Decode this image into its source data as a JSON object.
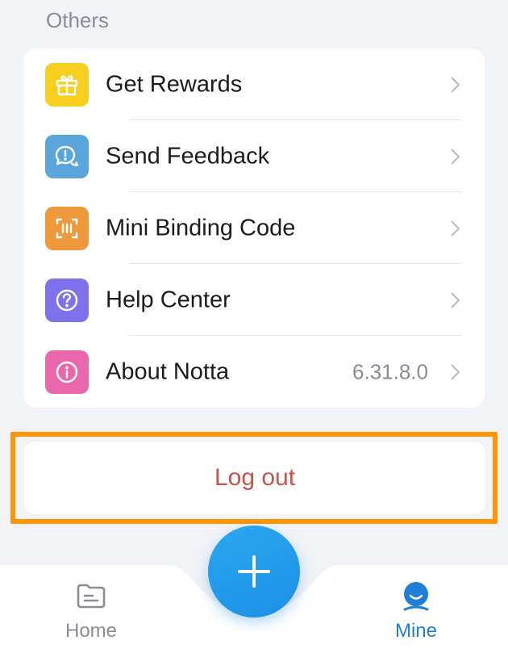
{
  "section": {
    "title": "Others"
  },
  "items": [
    {
      "label": "Get Rewards",
      "value": "",
      "icon": "gift-icon",
      "color": "#f7cf1e"
    },
    {
      "label": "Send Feedback",
      "value": "",
      "icon": "feedback-icon",
      "color": "#5aa6dc"
    },
    {
      "label": "Mini Binding Code",
      "value": "",
      "icon": "scan-code-icon",
      "color": "#ee9a3c"
    },
    {
      "label": "Help Center",
      "value": "",
      "icon": "help-icon",
      "color": "#7d72ec"
    },
    {
      "label": "About Notta",
      "value": "6.31.8.0",
      "icon": "info-icon",
      "color": "#ea67ad"
    }
  ],
  "logout": {
    "label": "Log out",
    "color": "#c6544a",
    "highlight_color": "#ff9500"
  },
  "tabbar": {
    "home": {
      "label": "Home",
      "icon": "folder-icon"
    },
    "add": {
      "icon": "plus-icon"
    },
    "mine": {
      "label": "Mine",
      "icon": "user-icon",
      "active": true
    }
  },
  "colors": {
    "accent": "#1f7fd6",
    "background": "#f2f3f7"
  }
}
